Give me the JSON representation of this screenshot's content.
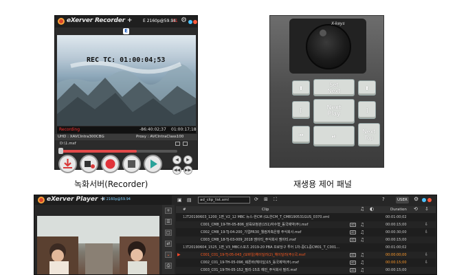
{
  "recorder": {
    "app_name": "eXerver Recorder +",
    "format": "E 2160p@59.94",
    "counter": "11",
    "badge": "E",
    "timecode_overlay": "REC TC: 01:00:04;53",
    "status": "Recording",
    "time_elapsed": "-86:40:02;37",
    "time_total": "01:00:17;18",
    "uhd_codec": "UHD : XAVCIntra300CBG",
    "proxy_codec": "Proxy : AVCIntraClass100",
    "file_path": "D:\\1.mxf",
    "progress_fraction": 0.65,
    "caption": "녹화서버(Recorder)"
  },
  "controller": {
    "brand": "X-keys",
    "keys": {
      "up_left": "⬆",
      "set_next": "Set\nNext",
      "up_right": "⬆",
      "bracket_left": "[",
      "next_play": "Next\nPlay",
      "bracket_right": "]",
      "prev": "⏮",
      "play_pause": "⏯",
      "next_top": "Next\nTop"
    },
    "caption": "재생용 제어 패널"
  },
  "player": {
    "app_name": "eXerver Player +",
    "format": "E 2160p@59.94",
    "playlist_name": "ad_clip_list.xml",
    "user_label": "USER",
    "help": "?",
    "columns": {
      "index": "#",
      "clip": "Clip",
      "duration": "Duration"
    },
    "rows": [
      {
        "type": "group",
        "num": "12",
        "clip": "T20190603_1200_1편_V2_12 MBC 뉴스-한CM (GL한CM_T_CM8190531GUS_0370.xml",
        "duration": "00:01:00;02"
      },
      {
        "type": "sub",
        "num": "",
        "clip": "C001_CM8_19-TH-05-806_삼육보청관(151)자수형_동국제약(주).mxf",
        "duration": "00:00:15;00",
        "ad": true,
        "arrow": "⇩"
      },
      {
        "type": "sub",
        "num": "",
        "clip": "C002_CM8_19-TJ-04-200_기업PR30_웰컴저축은행 주식회사.mxf",
        "duration": "00:00:30;00",
        "ad": true,
        "arrow": "⇩"
      },
      {
        "type": "sub",
        "num": "",
        "clip": "C003_CM8_18-TJ-03-009_2018 엠이티_주식회사 엠이티.mxf",
        "duration": "00:00:15;00",
        "ad": true,
        "arrow": ""
      },
      {
        "type": "group",
        "num": "13",
        "clip": "T20190604_1525_1편_V3_MBC스포츠 2019-20 PBA 프로당구 투어 1차-중CL중CM01_T_C001...",
        "duration": "00:01:00;02"
      },
      {
        "type": "sub",
        "active": true,
        "num": "",
        "clip": "C001_C01_19-TJ-05-043_(모바일)헤이딜러(2)_헤이딜러(주)(국.mxf",
        "duration": "00:00:00;00",
        "ad": true,
        "arrow": "⇩"
      },
      {
        "type": "sub",
        "num": "",
        "clip": "C002_C01_19-TH-05-096_웨폰바(헤이딜)15_동국제약(주).mxf",
        "duration": "00:00:15;00",
        "ad": true,
        "arrow": "⇩",
        "highlight": true
      },
      {
        "type": "sub",
        "num": "",
        "clip": "C003_C01_19-TH-05-152_필리-15초 예민_주식회사 필리.mxf",
        "duration": "00:00:15;00",
        "ad": true,
        "arrow": ""
      }
    ],
    "side_icons": [
      "+",
      "☰",
      "□",
      "⇄",
      "⌄",
      "⎙"
    ]
  },
  "colors": {
    "accent_red": "#e34a4a",
    "active_orange": "#ff5a1f",
    "window_bg": "#2b2b2b"
  }
}
